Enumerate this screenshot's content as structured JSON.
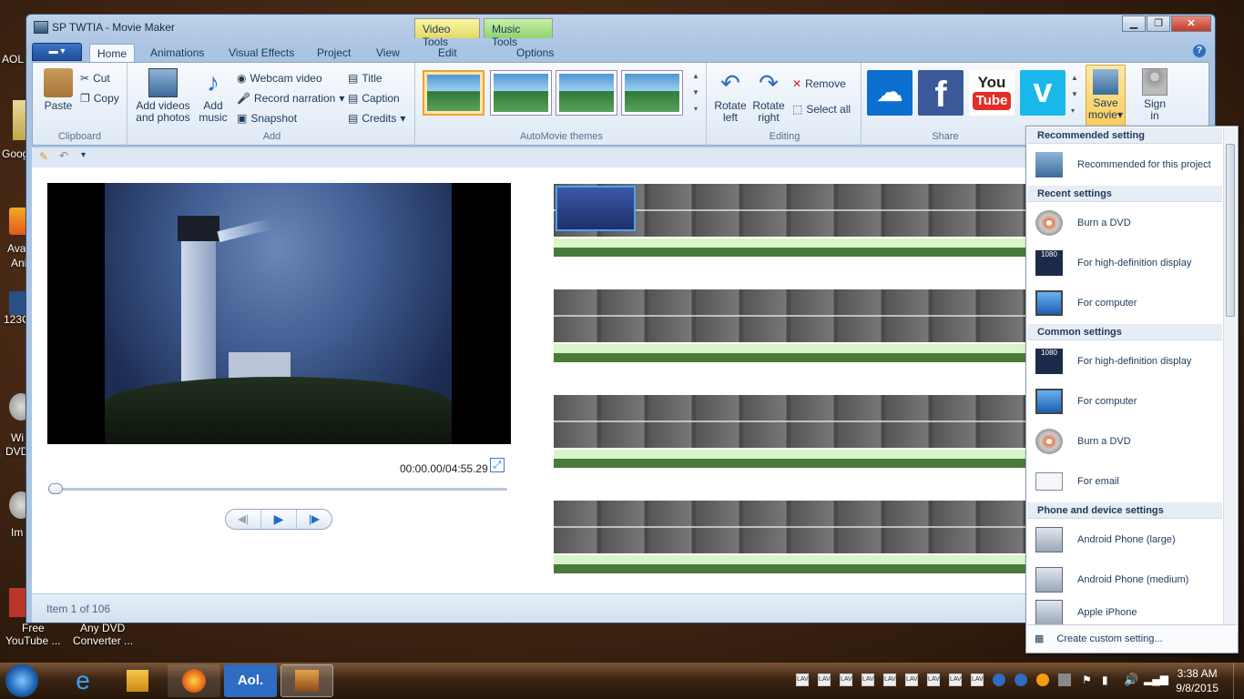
{
  "window": {
    "title": "SP TWTIA - Movie Maker",
    "context_tabs": [
      "Video Tools",
      "Music Tools"
    ],
    "close": "✕",
    "min": "▁",
    "max": "❐"
  },
  "tabs": {
    "home": "Home",
    "animations": "Animations",
    "visual_effects": "Visual Effects",
    "project": "Project",
    "view": "View",
    "edit": "Edit",
    "options": "Options"
  },
  "clipboard": {
    "paste": "Paste",
    "cut": "Cut",
    "copy": "Copy",
    "label": "Clipboard"
  },
  "add": {
    "add_videos": "Add videos",
    "add_videos2": "and photos",
    "add_music": "Add",
    "add_music2": "music",
    "webcam": "Webcam video",
    "narration": "Record narration",
    "snapshot": "Snapshot",
    "title": "Title",
    "caption": "Caption",
    "credits": "Credits",
    "label": "Add"
  },
  "automovie": {
    "label": "AutoMovie themes"
  },
  "editing": {
    "rotate_left": "Rotate",
    "rotate_left2": "left",
    "rotate_right": "Rotate",
    "rotate_right2": "right",
    "remove": "Remove",
    "select_all": "Select all",
    "label": "Editing"
  },
  "share": {
    "label": "Share",
    "save": "Save",
    "save2": "movie",
    "sign": "Sign",
    "sign2": "in",
    "colors": {
      "onedrive": "#0a6fcf",
      "facebook": "#3b5998",
      "youtube": "#e52d27",
      "vimeo": "#1ab7ea"
    },
    "youtube_text": "You",
    "youtube_text2": "Tube",
    "facebook_text": "f",
    "vimeo_text": "v"
  },
  "player": {
    "time": "00:00.00/04:55.29"
  },
  "status": {
    "text": "Item 1 of 106"
  },
  "menu": {
    "h1": "Recommended setting",
    "i1": "Recommended for this project",
    "h2": "Recent settings",
    "i2": "Burn a DVD",
    "i3": "For high-definition display",
    "i4": "For computer",
    "h3": "Common settings",
    "i5": "For high-definition display",
    "i6": "For computer",
    "i7": "Burn a DVD",
    "i8": "For email",
    "h4": "Phone and device settings",
    "i9": "Android Phone (large)",
    "i10": "Android Phone (medium)",
    "i11": "Apple iPhone",
    "footer": "Create custom setting...",
    "hd_badge": "1080"
  },
  "desktop": {
    "aol": "AOL",
    "goog": "Goog",
    "ava": "Ava",
    "ani": "Ani",
    "n123": "123C",
    "wi": "Wi",
    "dvd": "DVD",
    "im": "Im",
    "free": "Free",
    "youtube": "YouTube ...",
    "anydvd": "Any DVD",
    "converter": "Converter ..."
  },
  "taskbar": {
    "aol": "Aol.",
    "time": "3:38 AM",
    "date": "9/8/2015",
    "lav": "LAV"
  }
}
